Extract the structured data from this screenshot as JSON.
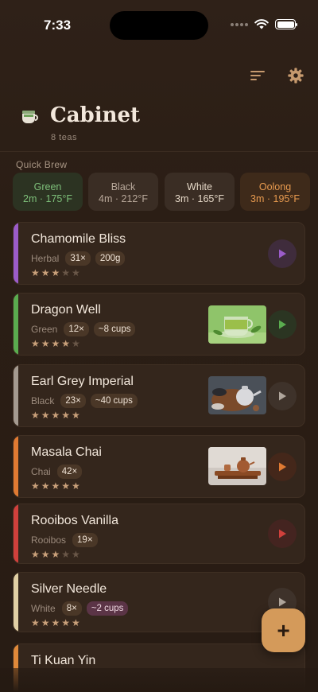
{
  "status_bar": {
    "time": "7:33"
  },
  "header": {
    "title": "Cabinet",
    "subtitle": "8 teas"
  },
  "quick_brew": {
    "label": "Quick Brew",
    "chips": [
      {
        "name": "Green",
        "meta": "2m · 175°F",
        "color": "#7ec07a"
      },
      {
        "name": "Black",
        "meta": "4m · 212°F",
        "color": "#b8a89a"
      },
      {
        "name": "White",
        "meta": "3m · 165°F",
        "color": "#e6d9c8"
      },
      {
        "name": "Oolong",
        "meta": "3m · 195°F",
        "color": "#e79a4f"
      }
    ]
  },
  "teas": [
    {
      "name": "Chamomile Bliss",
      "type": "Herbal",
      "count": "31×",
      "extra": "200g",
      "extra_style": "normal",
      "rating": 3,
      "accent": "#9b5cc9",
      "play_color": "#9b5cc9",
      "thumb": null
    },
    {
      "name": "Dragon Well",
      "type": "Green",
      "count": "12×",
      "extra": "~8 cups",
      "extra_style": "normal",
      "rating": 4,
      "accent": "#5aac4f",
      "play_color": "#5aac4f",
      "thumb": "green-tea-cup-photo"
    },
    {
      "name": "Earl Grey Imperial",
      "type": "Black",
      "count": "23×",
      "extra": "~40 cups",
      "extra_style": "normal",
      "rating": 5,
      "accent": "#a49a90",
      "play_color": "#b0a69c",
      "thumb": "teapot-photo"
    },
    {
      "name": "Masala Chai",
      "type": "Chai",
      "count": "42×",
      "extra": "",
      "extra_style": "normal",
      "rating": 5,
      "accent": "#e07a32",
      "play_color": "#e07a32",
      "thumb": "tea-tray-photo"
    },
    {
      "name": "Rooibos Vanilla",
      "type": "Rooibos",
      "count": "19×",
      "extra": "",
      "extra_style": "normal",
      "rating": 3,
      "accent": "#d0403c",
      "play_color": "#d0403c",
      "thumb": null
    },
    {
      "name": "Silver Needle",
      "type": "White",
      "count": "8×",
      "extra": "~2 cups",
      "extra_style": "purple",
      "rating": 5,
      "accent": "#e0cfa4",
      "play_color": "#b0a69c",
      "thumb": null
    },
    {
      "name": "Ti Kuan Yin",
      "type": "",
      "count": "",
      "extra": "",
      "extra_style": "normal",
      "rating": 0,
      "accent": "#e0893a",
      "play_color": "#e0893a",
      "thumb": null
    }
  ],
  "fab": {
    "label": "+"
  }
}
